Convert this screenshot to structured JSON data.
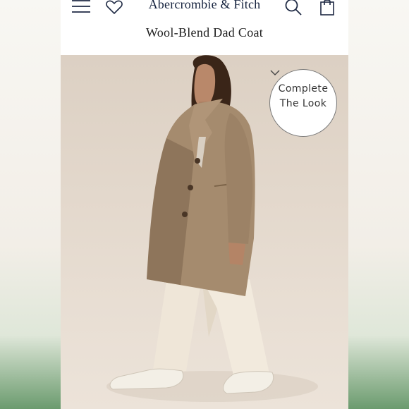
{
  "header": {
    "brand": "Abercrombie & Fitch",
    "icons": {
      "menu": "menu-icon",
      "wishlist": "heart-icon",
      "search": "search-icon",
      "bag": "bag-icon"
    }
  },
  "product": {
    "title": "Wool-Blend Dad Coat"
  },
  "complete_look": {
    "line1": "Complete",
    "line2": "The Look",
    "icon": "chevron-down-icon"
  },
  "colors": {
    "brand": "#14213d",
    "coat": "#a58b6e",
    "pants": "#efe6d8",
    "photo_bg": "#e3d8cc"
  }
}
